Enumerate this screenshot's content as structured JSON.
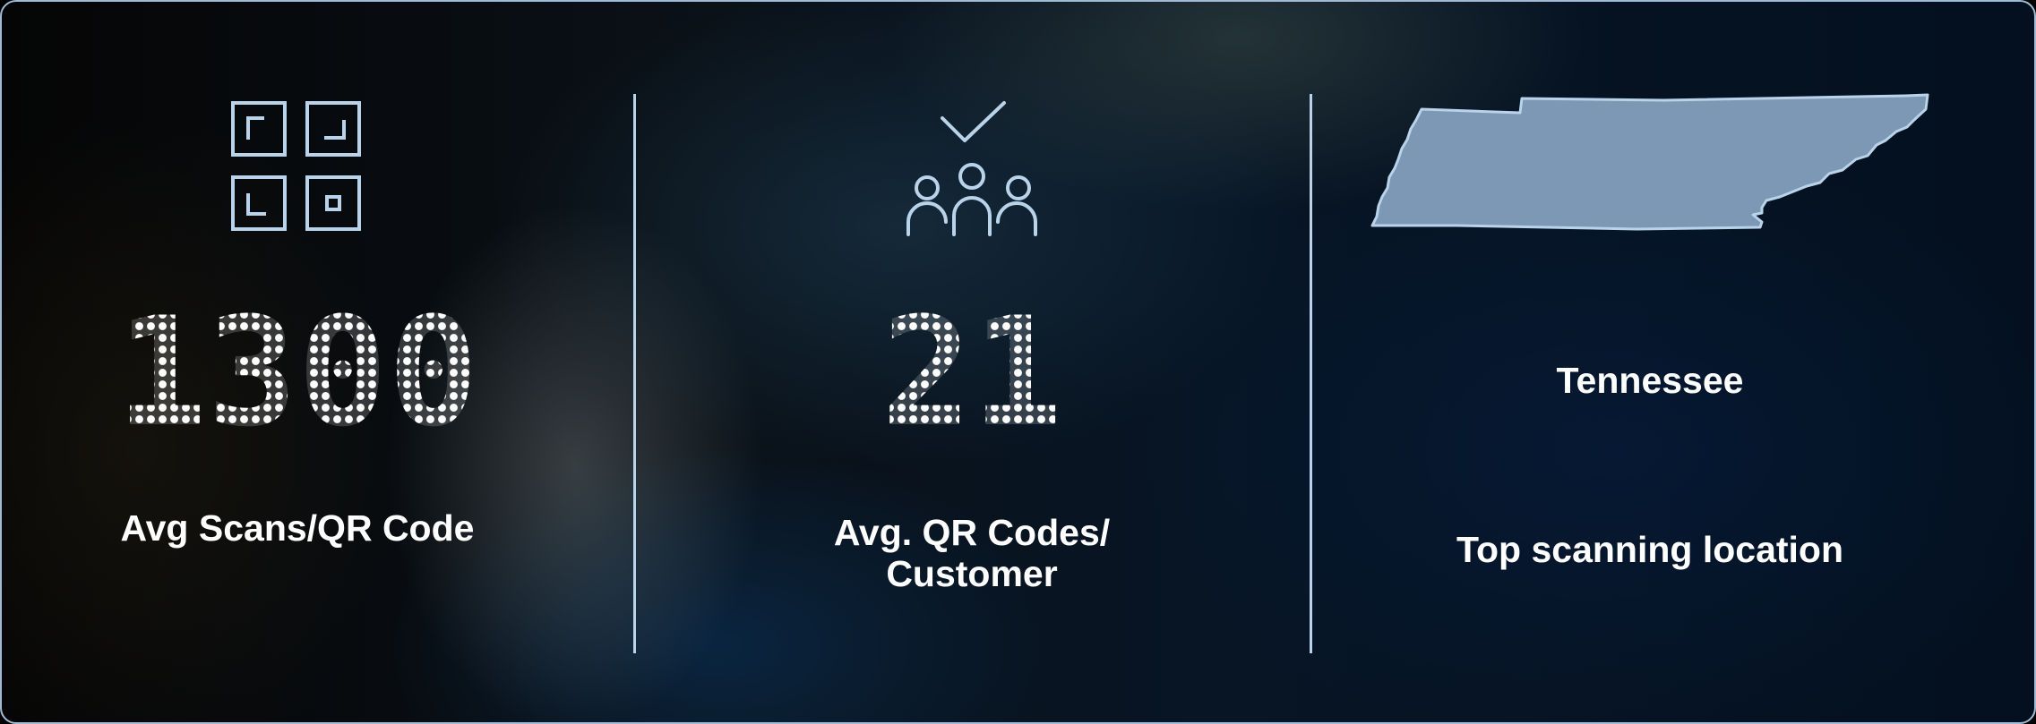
{
  "metrics": [
    {
      "icon": "qr-code-icon",
      "value": "1300",
      "label": "Avg Scans/QR Code"
    },
    {
      "icon": "customers-check-icon",
      "value": "21",
      "label_line1": "Avg. QR Codes/",
      "label_line2": "Customer"
    },
    {
      "icon": "tennessee-map",
      "value": "Tennessee",
      "label": "Top scanning location"
    }
  ],
  "colors": {
    "accent": "#b9d3ea",
    "map_fill": "#7d98b5",
    "text": "#ffffff"
  }
}
